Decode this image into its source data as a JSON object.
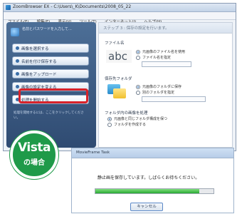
{
  "window": {
    "title": "ZoomBrowser EX - C:\\Users\\_K\\Documents\\2008_05_22",
    "menu": [
      "ファイル(F)",
      "編集(E)",
      "表示(V)",
      "ツール(T)",
      "インターネット(I)",
      "ヘルプ(H)"
    ]
  },
  "sidebar": {
    "header": "名前とパスワードを入力して…",
    "items": [
      {
        "label": "画像を選択する"
      },
      {
        "label": "名前を付け保存する"
      },
      {
        "label": "画像をアップロード"
      },
      {
        "label": "画像の設定を変える"
      },
      {
        "label": "処理を開始する"
      }
    ],
    "description": "処理を開始するには、ここをクリックしてください。"
  },
  "content": {
    "header_text": "ステップ 3 : 保存の設定を行います。",
    "file_section": "ファイル名",
    "file_sample": "abc",
    "file_options": [
      "元画像のファイル名を使用",
      "ファイル名を指定"
    ],
    "folder_section": "保存先フォルダ",
    "folder_options": [
      "元画像のフォルダに保存",
      "別のフォルダを指定"
    ],
    "subfolder_section": "フォルダ内の画像を処理",
    "subfolder_options": [
      "元画像と同じフォルダ構成を保つ",
      "フォルダを作成する"
    ]
  },
  "badge": {
    "line1": "Vista",
    "line2": "の場合"
  },
  "dialog": {
    "title": "MovieFrame Task",
    "message": "静止画を保存しています。しばらくお待ちください。",
    "progress_fraction": 0.88,
    "cancel_label": "キャンセル"
  },
  "colors": {
    "highlight": "#d8232a",
    "badge": "#1f9a49",
    "progress": "#2aa834"
  }
}
